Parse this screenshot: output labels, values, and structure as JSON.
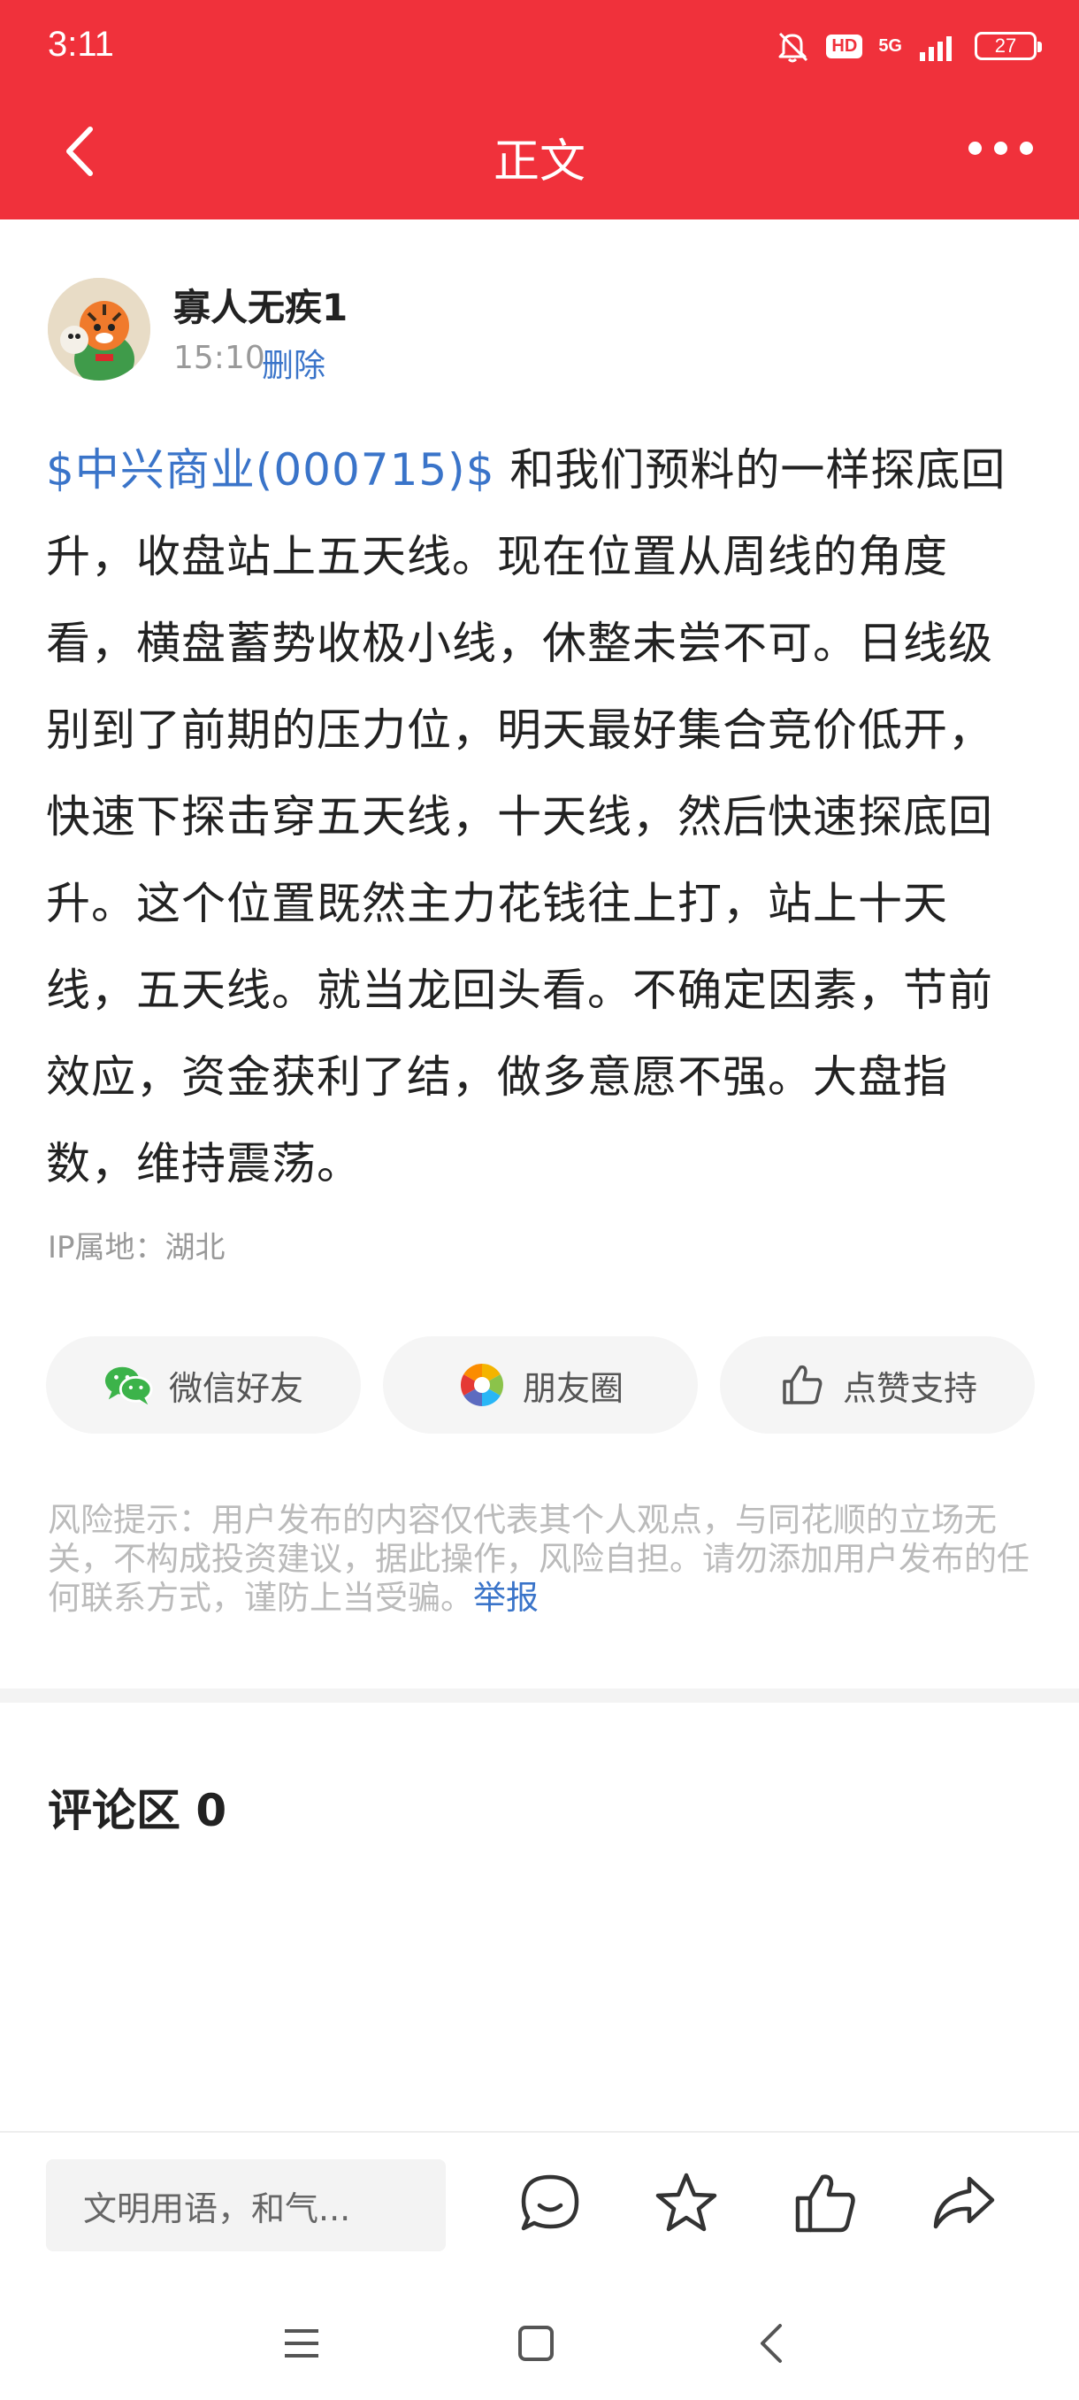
{
  "status_bar": {
    "time": "3:11",
    "hd": "HD",
    "network": "5G",
    "battery": "27"
  },
  "nav": {
    "title": "正文"
  },
  "author": {
    "name": "寡人无疾1",
    "time": "15:10",
    "delete_label": "删除"
  },
  "post": {
    "stock_tag": "$中兴商业(000715)$",
    "text": " 和我们预料的一样探底回升，收盘站上五天线。现在位置从周线的角度看，横盘蓄势收极小线，休整未尝不可。日线级别到了前期的压力位，明天最好集合竞价低开，快速下探击穿五天线，十天线，然后快速探底回升。这个位置既然主力花钱往上打，站上十天线，五天线。就当龙回头看。不确定因素，节前效应，资金获利了结，做多意愿不强。大盘指数，维持震荡。",
    "ip_location": "IP属地：湖北"
  },
  "share": {
    "wechat_label": "微信好友",
    "moments_label": "朋友圈",
    "like_label": "点赞支持"
  },
  "disclaimer": {
    "text": "风险提示：用户发布的内容仅代表其个人观点，与同花顺的立场无关，不构成投资建议，据此操作，风险自担。请勿添加用户发布的任何联系方式，谨防上当受骗。",
    "report_label": "举报"
  },
  "comments": {
    "title": "评论区 0"
  },
  "bottom_bar": {
    "input_placeholder": "文明用语，和气..."
  },
  "colors": {
    "brand_red": "#f0313b",
    "link_blue": "#3a74c9",
    "wechat_green": "#3cb34a"
  }
}
